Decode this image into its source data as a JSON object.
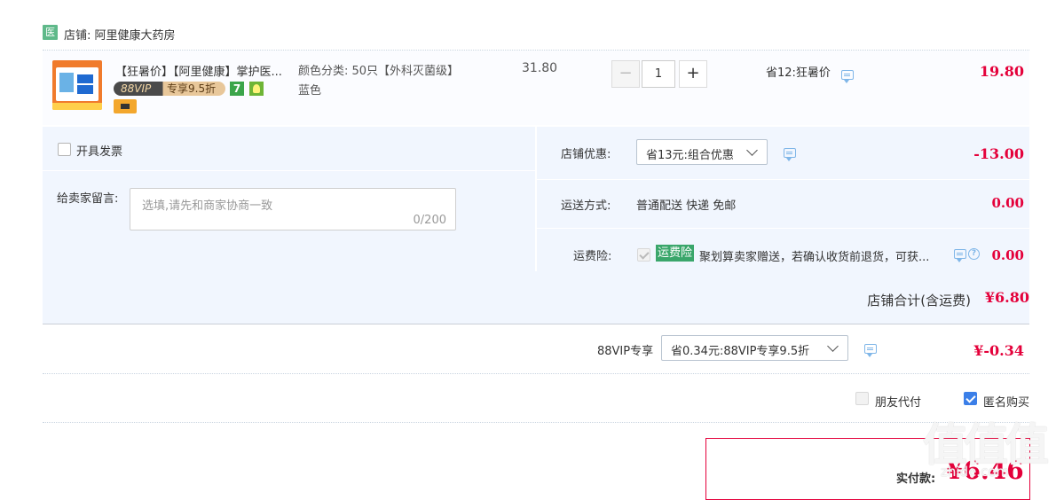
{
  "store": {
    "badge": "医",
    "name": "店铺: 阿里健康大药房"
  },
  "item": {
    "title": "【狂暑价】【阿里健康】掌护医...",
    "vip_left": "88VIP",
    "vip_right": "专享9.5折",
    "badge_7": "7",
    "sku_label": "颜色分类: 50只【外科灭菌级】",
    "sku_color": "蓝色",
    "orig_price": "31.80",
    "qty_minus": "−",
    "qty": "1",
    "qty_plus": "+",
    "promo": "省12:狂暑价",
    "price": "19.80"
  },
  "invoice": {
    "label": "开具发票",
    "checked": false
  },
  "message": {
    "label": "给卖家留言:",
    "placeholder": "选填,请先和商家协商一致",
    "count": "0/200"
  },
  "discount": {
    "label": "店铺优惠:",
    "selected": "省13元:组合优惠",
    "amount": "-13.00"
  },
  "shipping": {
    "label": "运送方式:",
    "value": "普通配送 快递 免邮",
    "amount": "0.00"
  },
  "insurance": {
    "label": "运费险:",
    "tag": "运费险",
    "text": "聚划算卖家赠送，若确认收货前退货，可获...",
    "help": "?",
    "amount": "0.00"
  },
  "store_total": {
    "label": "店铺合计(含运费)",
    "amount": "¥6.80"
  },
  "vip": {
    "label": "88VIP专享",
    "selected": "省0.34元:88VIP专享9.5折",
    "amount": "¥-0.34"
  },
  "options": {
    "friend_pay": "朋友代付",
    "anonymous": "匿名购买",
    "anonymous_checked": true
  },
  "payment": {
    "label": "实付款:",
    "amount": "¥6.46"
  },
  "watermark": {
    "main": "值值值",
    "sub": "zhide.com"
  }
}
